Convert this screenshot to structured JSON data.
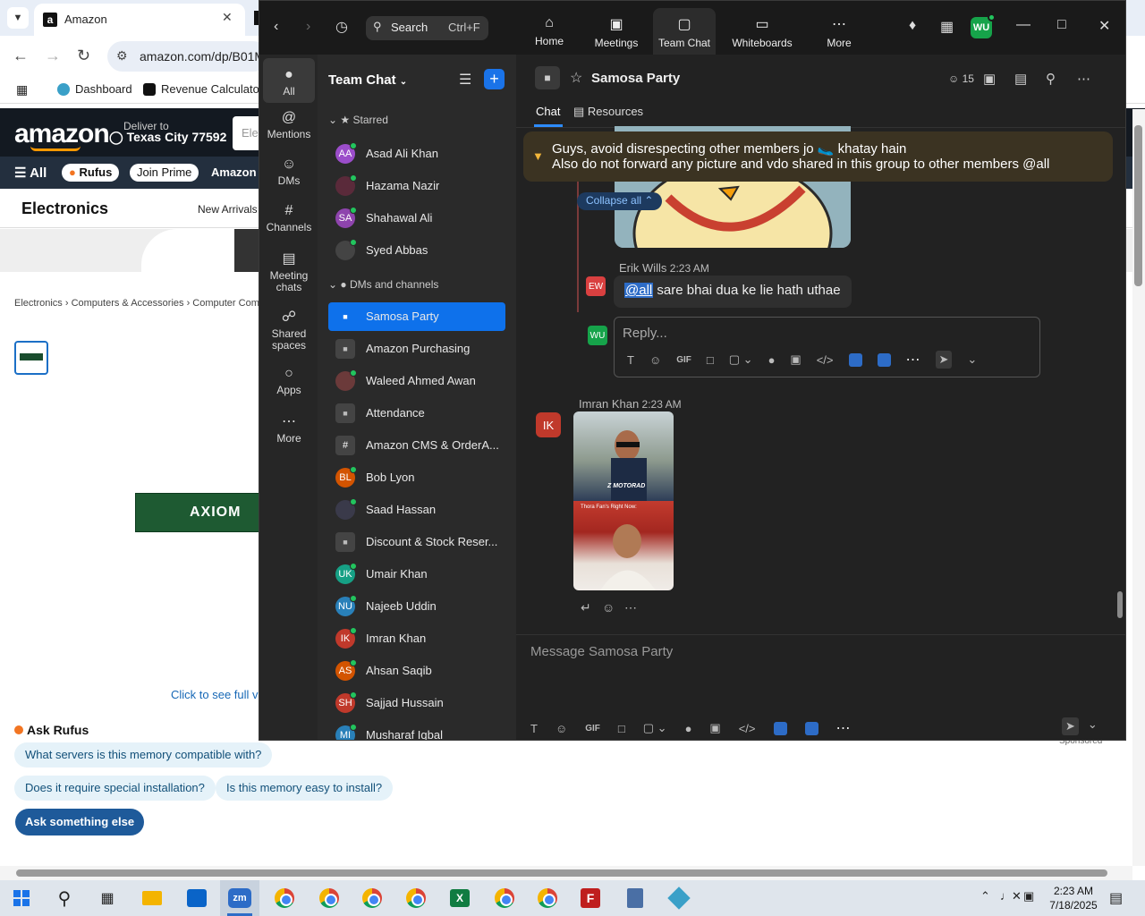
{
  "browser": {
    "tab_title": "Amazon",
    "url": "amazon.com/dp/B01M",
    "bookmarks": [
      "Dashboard",
      "Revenue Calculator"
    ],
    "amazon": {
      "logo": "amazon",
      "deliver_to": "Deliver to",
      "location": "Texas City 77592",
      "search_placeholder": "Elec",
      "nav_all": "All",
      "nav_rufus": "Rufus",
      "nav_join_prime": "Join Prime",
      "nav_link": "Amazon H",
      "category_title": "Electronics",
      "category_link": "New Arrivals",
      "breadcrumb": "Electronics › Computers & Accessories › Computer Com",
      "product_brand": "AXIOM",
      "see_full_view": "Click to see full vi",
      "ask_rufus": "Ask Rufus",
      "rufus_questions": [
        "What servers is this memory compatible with?",
        "Does it require special installation?",
        "Is this memory easy to install?"
      ],
      "ask_else": "Ask something else",
      "sponsored": "Sponsored"
    }
  },
  "zoom": {
    "search_label": "Search",
    "search_shortcut": "Ctrl+F",
    "top_tabs": [
      {
        "label": "Home",
        "icon": "home-icon"
      },
      {
        "label": "Meetings",
        "icon": "video-icon"
      },
      {
        "label": "Team Chat",
        "icon": "chat-icon"
      },
      {
        "label": "Whiteboards",
        "icon": "whiteboard-icon"
      },
      {
        "label": "More",
        "icon": "more-icon"
      }
    ],
    "user_initials": "WU",
    "rail": [
      {
        "label": "All"
      },
      {
        "label": "Mentions"
      },
      {
        "label": "DMs"
      },
      {
        "label": "Channels"
      },
      {
        "label": "Meeting chats"
      },
      {
        "label": "Shared spaces"
      },
      {
        "label": "Apps"
      },
      {
        "label": "More"
      }
    ],
    "sidebar": {
      "title": "Team Chat",
      "starred_label": "Starred",
      "starred": [
        {
          "name": "Asad Ali Khan",
          "initials": "AA",
          "color": "#9b4dca"
        },
        {
          "name": "Hazama Nazir",
          "initials": "",
          "color": "#5a2a3a"
        },
        {
          "name": "Shahawal Ali",
          "initials": "SA",
          "color": "#8e44ad"
        },
        {
          "name": "Syed Abbas",
          "initials": "",
          "color": "#444444"
        }
      ],
      "dms_label": "DMs and channels",
      "items": [
        {
          "name": "Samosa Party",
          "initials": "",
          "color": "#0e71eb"
        },
        {
          "name": "Amazon Purchasing",
          "initials": "",
          "color": "#444444"
        },
        {
          "name": "Waleed Ahmed Awan",
          "initials": "",
          "color": "#6b3a3a"
        },
        {
          "name": "Attendance",
          "initials": "",
          "color": "#444444"
        },
        {
          "name": "Amazon CMS & OrderA...",
          "initials": "#",
          "color": "#444444"
        },
        {
          "name": "Bob Lyon",
          "initials": "BL",
          "color": "#d35400"
        },
        {
          "name": "Saad Hassan",
          "initials": "",
          "color": "#3a3a4a"
        },
        {
          "name": "Discount & Stock Reser...",
          "initials": "",
          "color": "#444444"
        },
        {
          "name": "Umair Khan",
          "initials": "UK",
          "color": "#16a085"
        },
        {
          "name": "Najeeb Uddin",
          "initials": "NU",
          "color": "#2980b9"
        },
        {
          "name": "Imran Khan",
          "initials": "IK",
          "color": "#c0392b"
        },
        {
          "name": "Ahsan Saqib",
          "initials": "AS",
          "color": "#d35400"
        },
        {
          "name": "Sajjad Hussain",
          "initials": "SH",
          "color": "#c0392b"
        },
        {
          "name": "Musharaf Iqbal",
          "initials": "MI",
          "color": "#2980b9"
        }
      ]
    },
    "channel": {
      "title": "Samosa Party",
      "member_count": "15",
      "tabs": [
        "Chat",
        "Resources"
      ],
      "pinned_line1": "Guys, avoid disrespecting other members jo 🥿 khatay hain",
      "pinned_line2": "Also do not forward any picture and vdo shared in this group to other members @all",
      "collapse_all": "Collapse all",
      "messages": [
        {
          "initials": "EW",
          "author": "Erik Wills",
          "time": "2:23 AM",
          "mention": "@all",
          "text": " sare bhai dua ke lie hath uthae"
        },
        {
          "initials": "IK",
          "author": "Imran Khan",
          "time": "2:23 AM",
          "caption1": "Z MOTORAD",
          "caption2": "Thora Fan's Right Now:"
        }
      ],
      "reply_initials": "WU",
      "reply_placeholder": "Reply...",
      "compose_placeholder": "Message Samosa Party"
    }
  },
  "taskbar": {
    "zoom_label": "zm",
    "time": "2:23 AM",
    "date": "7/18/2025"
  }
}
